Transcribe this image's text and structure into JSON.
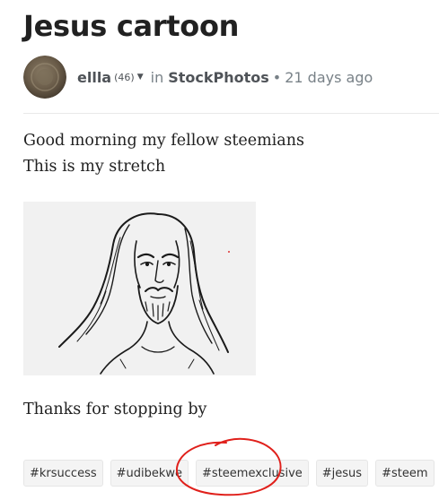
{
  "post": {
    "title": "Jesus cartoon",
    "author": "ellla",
    "reputation": "(46)",
    "in_word": "in",
    "community": "StockPhotos",
    "separator": "•",
    "time_ago": "21 days ago",
    "paragraphs": [
      "Good morning my fellow steemians",
      "This is my stretch"
    ],
    "closing": "Thanks for stopping by",
    "image_icon": "jesus-sketch-image"
  },
  "tags": [
    "#krsuccess",
    "#udibekwe",
    "#steemexclusive",
    "#jesus",
    "#steem"
  ],
  "colors": {
    "title": "#212121",
    "meta": "#788187",
    "annotation": "#e0201b"
  }
}
